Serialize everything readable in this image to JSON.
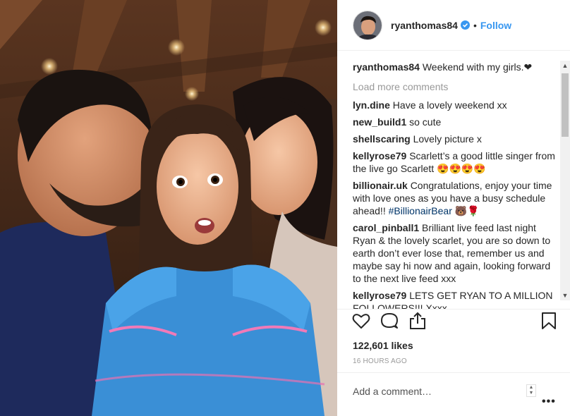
{
  "post": {
    "username": "ryanthomas84",
    "follow_label": "Follow",
    "separator": "•",
    "caption": {
      "username": "ryanthomas84",
      "text": "Weekend with my girls.❤"
    },
    "load_more": "Load more comments",
    "comments": [
      {
        "user": "lyn.dine",
        "text": "Have a lovely weekend xx"
      },
      {
        "user": "new_build1",
        "text": "so cute"
      },
      {
        "user": "shellscaring",
        "text": "Lovely picture x"
      },
      {
        "user": "kellyrose79",
        "text": "Scarlett’s a good little singer from the live go Scarlett 😍😍😍😍"
      },
      {
        "user": "billionair.uk",
        "text": "Congratulations, enjoy your time with love ones as you have a busy schedule ahead!! ",
        "hashtag": "#BillionairBear",
        "suffix": " 🐻🌹"
      },
      {
        "user": "carol_pinball1",
        "text": "Brilliant live feed last night Ryan & the lovely scarlet, you are so down to earth don’t ever lose that, remember us and maybe say hi now and again, looking forward to the next live feed xxx"
      },
      {
        "user": "kellyrose79",
        "text": "LETS GET RYAN TO A MILLION FOLLOWERS!!! Xxxx"
      }
    ],
    "likes": "122,601 likes",
    "timestamp": "16 HOURS AGO",
    "add_comment_placeholder": "Add a comment…",
    "more_options": "•••"
  },
  "icons": {
    "like": "heart-outline-icon",
    "comment": "speech-bubble-icon",
    "share": "share-icon",
    "save": "bookmark-icon",
    "verified": "verified-badge-icon"
  },
  "colors": {
    "link_blue": "#3897f0",
    "hashtag": "#003569",
    "muted": "#999999",
    "text": "#262626"
  }
}
